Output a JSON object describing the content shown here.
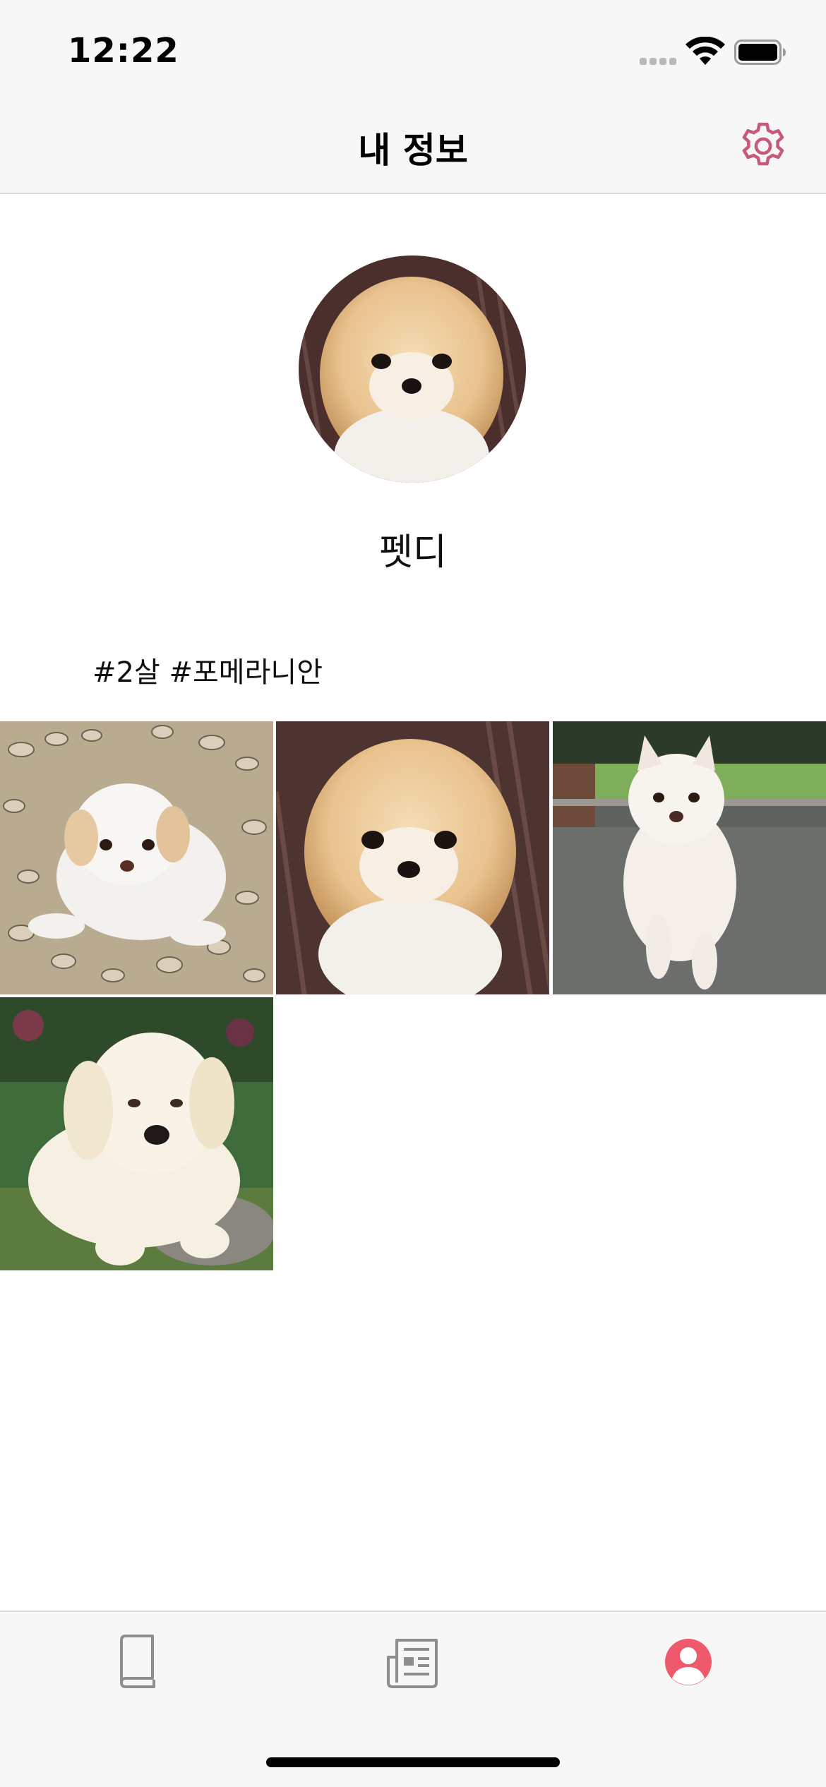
{
  "status_bar": {
    "time": "12:22",
    "icons": [
      "cellular-signal-icon",
      "wifi-icon",
      "battery-icon"
    ]
  },
  "nav": {
    "title": "내 정보",
    "settings_icon": "gear-icon",
    "accent_color": "#c75a7a"
  },
  "profile": {
    "name": "펫디",
    "tags": "#2살 #포메라니안",
    "avatar_icon": "pomeranian-photo"
  },
  "photos": [
    {
      "subject": "white-puppy-on-gravel-photo"
    },
    {
      "subject": "pomeranian-photo"
    },
    {
      "subject": "white-samoyed-puppy-running-photo"
    },
    {
      "subject": "golden-retriever-puppy-on-grass-photo"
    }
  ],
  "tabs": [
    {
      "icon": "book-icon",
      "selected": false
    },
    {
      "icon": "newspaper-icon",
      "selected": false
    },
    {
      "icon": "profile-icon",
      "selected": true
    }
  ],
  "colors": {
    "tab_inactive": "#8e8e8e",
    "tab_active": "#ee5a6b",
    "bar_background": "#f7f7f7"
  }
}
